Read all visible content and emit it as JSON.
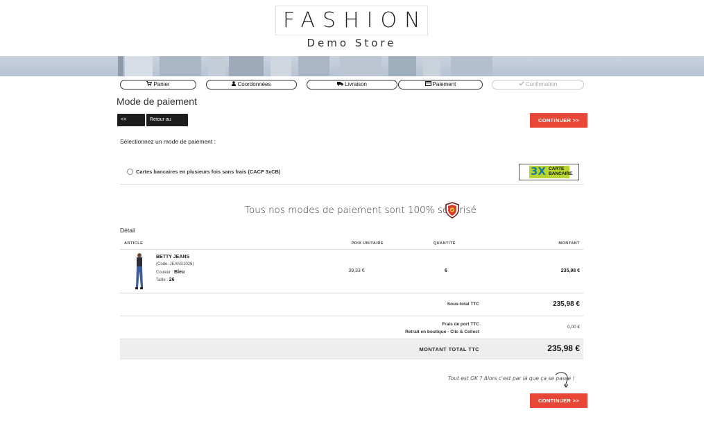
{
  "header": {
    "logo_main": "FASHION",
    "logo_sub": "Demo Store"
  },
  "steps": [
    {
      "label": "Panier",
      "icon": "cart-icon",
      "enabled": true
    },
    {
      "label": "Coordonnées",
      "icon": "user-icon",
      "enabled": true
    },
    {
      "label": "Livraison",
      "icon": "truck-icon",
      "enabled": true
    },
    {
      "label": "Paiement",
      "icon": "credit-card-icon",
      "enabled": true
    },
    {
      "label": "Confirmation",
      "icon": "check-icon",
      "enabled": false
    }
  ],
  "page": {
    "title": "Mode de paiement",
    "back_label": "<< Retour",
    "back_cart_label": "Retour au panier",
    "continue_label": "CONTINUER >>",
    "select_label": "Sélectionnez un mode de paiement :"
  },
  "payment_option": {
    "label": "Cartes bancaires en plusieurs fois sans frais (CACF 3xCB)",
    "logo_text_big": "3X",
    "logo_text_small_1": "CARTE",
    "logo_text_small_2": "BANCAIRE"
  },
  "secure_text": "Tous nos modes de paiement sont 100% sécurisé",
  "detail": {
    "title": "Détail",
    "columns": {
      "article": "ARTICLE",
      "unit_price": "PRIX UNITAIRE",
      "quantity": "QUANTITÉ",
      "amount": "MONTANT"
    },
    "product": {
      "name": "BETTY JEANS",
      "code": "(Code: JEANS1026)",
      "color_label": "Couleur : ",
      "color_value": "Bleu",
      "size_label": "Taille : ",
      "size_value": "26",
      "unit_price": "39,33 €",
      "quantity": "6",
      "amount": "235,98 €"
    },
    "subtotal_label": "Sous-total TTC",
    "subtotal_value": "235,98 €",
    "shipping_label_1": "Frais de port TTC",
    "shipping_label_2": "Retrait en boutique - Clic & Collect",
    "shipping_value": "0,00 €",
    "total_label": "MONTANT TOTAL TTC",
    "total_value": "235,98 €"
  },
  "hint": "Tout est OK ? Alors c'est par là que ça se passe !",
  "colors": {
    "accent": "#e84637",
    "dark_button": "#1d1d1d"
  }
}
